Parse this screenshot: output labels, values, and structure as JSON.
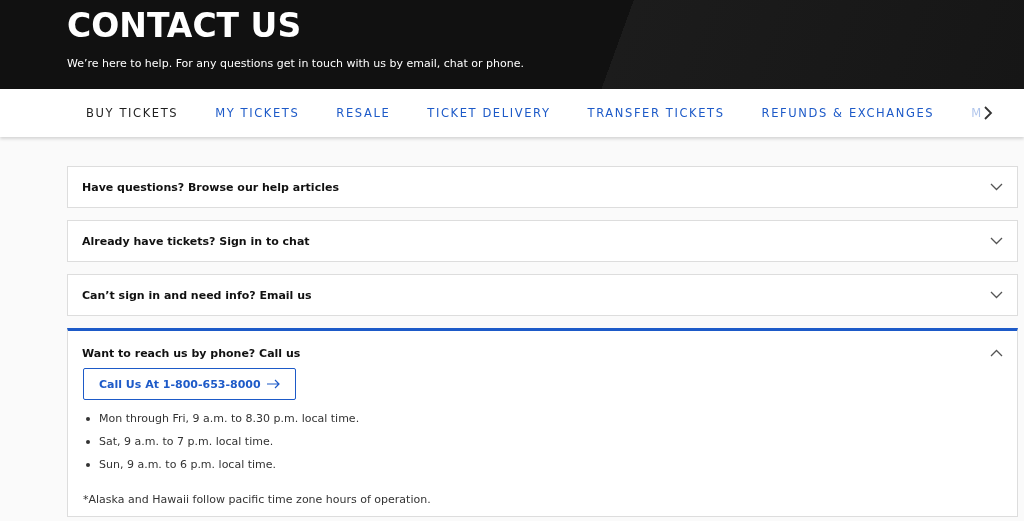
{
  "header": {
    "title": "CONTACT US",
    "subtitle": "We’re here to help. For any questions get in touch with us by email, chat or phone."
  },
  "tabs": [
    {
      "label": "BUY TICKETS",
      "selected": true
    },
    {
      "label": "MY TICKETS",
      "selected": false
    },
    {
      "label": "RESALE",
      "selected": false
    },
    {
      "label": "TICKET DELIVERY",
      "selected": false
    },
    {
      "label": "TRANSFER TICKETS",
      "selected": false
    },
    {
      "label": "REFUNDS & EXCHANGES",
      "selected": false
    },
    {
      "label": "M",
      "selected": false
    }
  ],
  "accordion": [
    {
      "title": "Have questions? Browse our help articles",
      "expanded": false
    },
    {
      "title": "Already have tickets? Sign in to chat",
      "expanded": false
    },
    {
      "title": "Can’t sign in and need info? Email us",
      "expanded": false
    },
    {
      "title": "Want to reach us by phone? Call us",
      "expanded": true,
      "button": "Call Us At 1-800-653-8000",
      "hours": [
        "Mon through Fri, 9 a.m. to 8.30 p.m. local time.",
        "Sat, 9 a.m. to 7 p.m. local time.",
        "Sun, 9 a.m. to 6 p.m. local time."
      ],
      "note": "*Alaska and Hawaii follow pacific time zone hours of operation."
    }
  ]
}
